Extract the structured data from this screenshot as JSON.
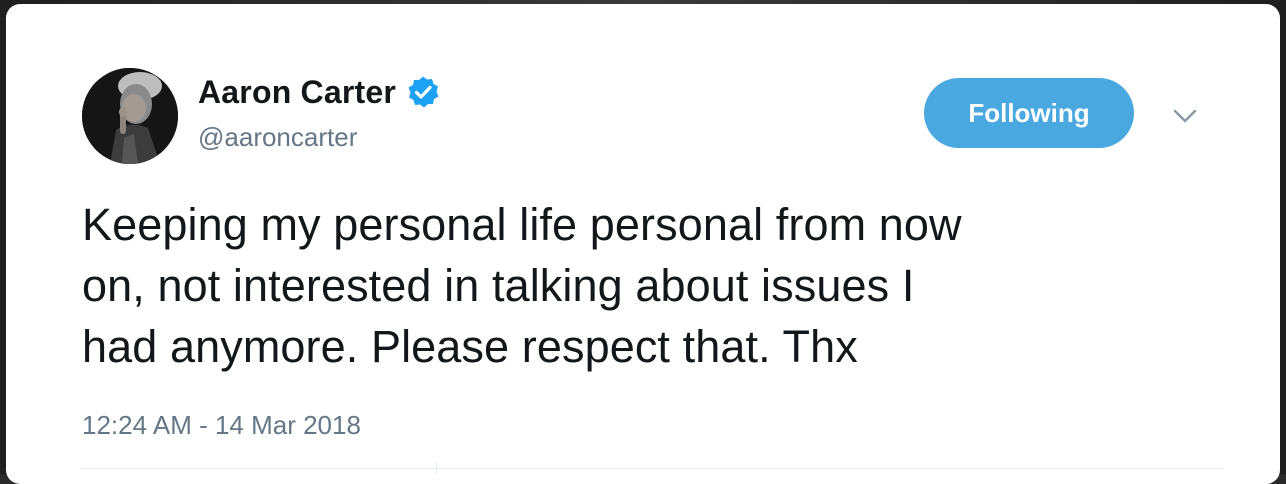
{
  "tweet": {
    "author": {
      "display_name": "Aaron Carter",
      "handle": "@aaroncarter",
      "verified_icon": "verified-badge-icon",
      "avatar": "profile-photo"
    },
    "follow_button_label": "Following",
    "menu_icon": "chevron-down-icon",
    "text_lines": [
      "Keeping my personal life personal from now",
      "on, not interested in talking about issues I",
      "had anymore. Please respect that. Thx"
    ],
    "timestamp": "12:24 AM - 14 Mar 2018"
  },
  "colors": {
    "accent": "#4aa8e0",
    "verified": "#1da1f2",
    "text_primary": "#14171a",
    "text_secondary": "#657786"
  }
}
